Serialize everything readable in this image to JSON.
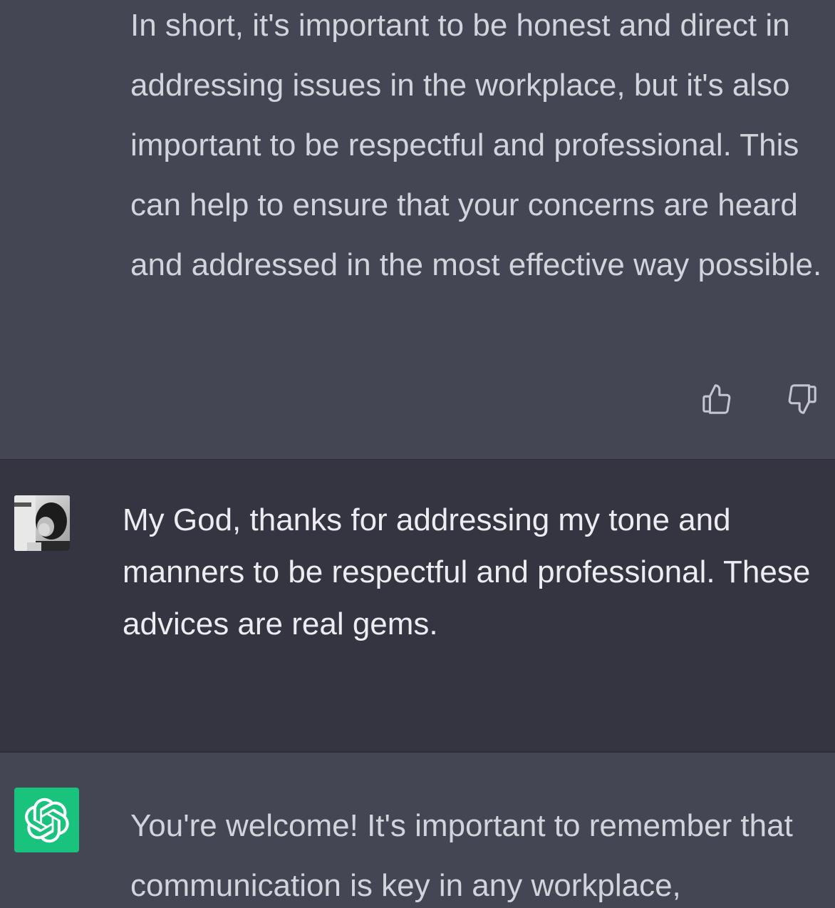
{
  "conversation": {
    "assistant_previous": {
      "text": "In short, it's important to be honest and direct in addressing issues in the workplace, but it's also important to be respectful and professional. This can help to ensure that your concerns are heard and addressed in the most effective way possible.",
      "feedback": {
        "thumbs_up_icon": "thumbs-up-icon",
        "thumbs_down_icon": "thumbs-down-icon"
      }
    },
    "user_message": {
      "avatar_icon": "user-avatar",
      "text": "My God, thanks for addressing my tone and manners to be respectful and professional. These advices are real gems."
    },
    "assistant_reply": {
      "avatar_icon": "openai-logo-icon",
      "text": "You're welcome! It's important to remember that communication is key in any workplace,"
    }
  },
  "colors": {
    "assistant_bg": "#444654",
    "user_bg": "#343541",
    "text": "#d1d5db",
    "gpt_avatar_bg": "#19c37d"
  }
}
